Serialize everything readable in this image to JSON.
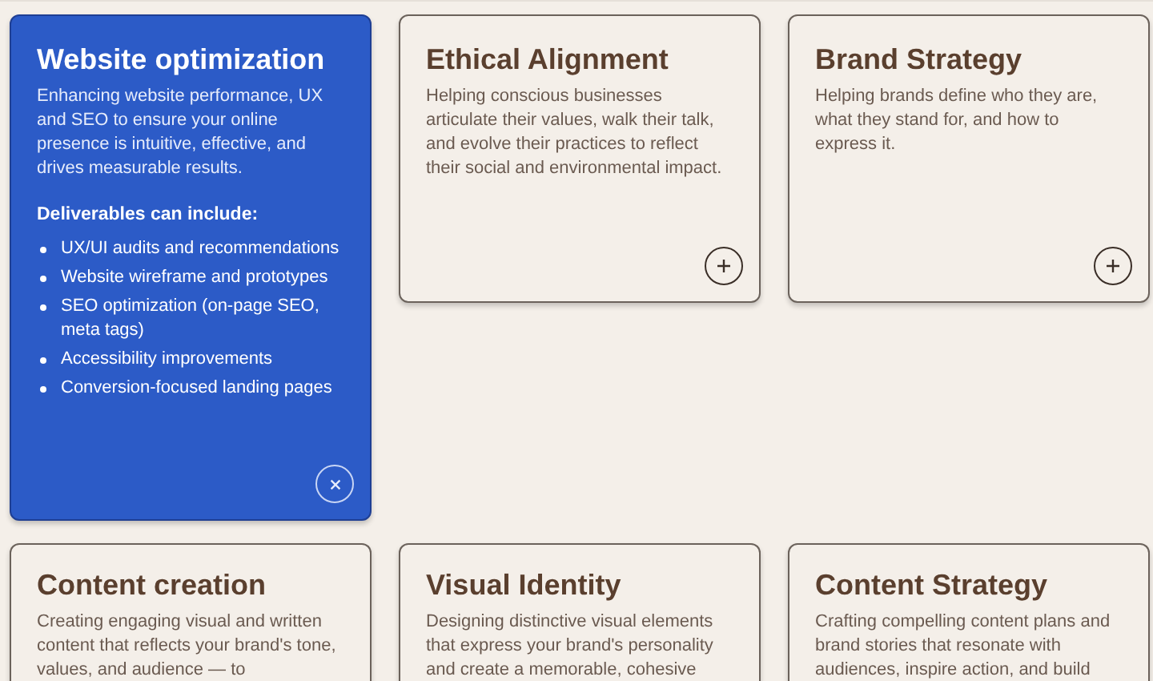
{
  "cards": [
    {
      "title": "Website optimization",
      "description": "Enhancing website performance, UX and SEO to ensure your online presence is intuitive, effective, and drives measurable results.",
      "expanded": true,
      "deliverables_heading": "Deliverables can include:",
      "deliverables": [
        "UX/UI audits and recommendations",
        "Website wireframe and prototypes",
        "SEO optimization (on-page SEO, meta tags)",
        "Accessibility improvements",
        "Conversion-focused landing pages"
      ]
    },
    {
      "title": "Ethical Alignment",
      "description": "Helping conscious businesses articulate their values, walk their talk, and evolve their practices to reflect their social and environmental impact.",
      "expanded": false
    },
    {
      "title": "Brand Strategy",
      "description": "Helping brands define who they are, what they stand for, and how to express it.",
      "expanded": false
    },
    {
      "title": "Content creation",
      "description": "Creating engaging visual and written content that reflects your brand's tone, values, and audience — to",
      "expanded": false
    },
    {
      "title": "Visual Identity",
      "description": "Designing distinctive visual elements that express your brand's personality and create a memorable, cohesive",
      "expanded": false
    },
    {
      "title": "Content Strategy",
      "description": "Crafting compelling content plans and brand stories that resonate with audiences, inspire action, and build",
      "expanded": false
    }
  ]
}
